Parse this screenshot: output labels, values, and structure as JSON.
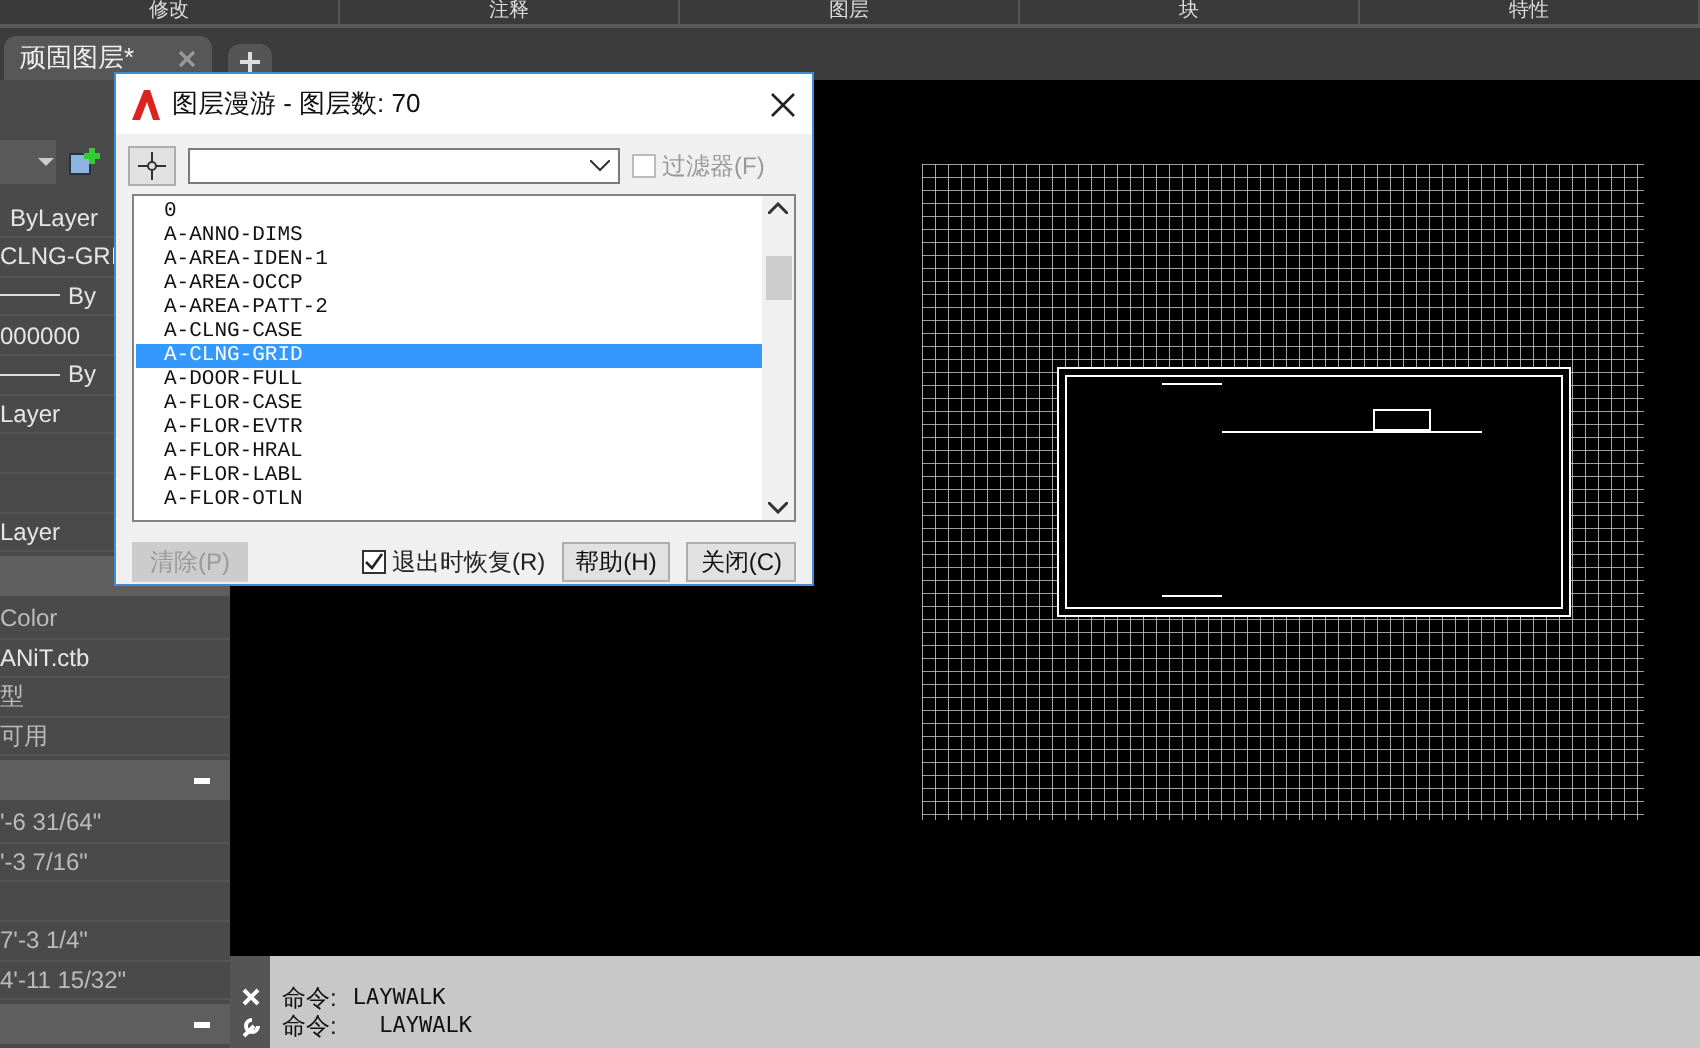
{
  "ribbon_panels": [
    {
      "label": "修改"
    },
    {
      "label": "注释"
    },
    {
      "label": "图层"
    },
    {
      "label": "块"
    },
    {
      "label": "特性"
    }
  ],
  "document_tabs": [
    {
      "label": "顽固图层*",
      "selected": true
    }
  ],
  "properties_palette": {
    "rows": [
      {
        "kind": "dropdown"
      },
      {
        "kind": "text",
        "text": "ByLayer",
        "indent": true
      },
      {
        "kind": "text",
        "text": "CLNG-GRI"
      },
      {
        "kind": "line",
        "text": "By"
      },
      {
        "kind": "text",
        "text": "000000"
      },
      {
        "kind": "line",
        "text": "By"
      },
      {
        "kind": "text",
        "text": "Layer"
      },
      {
        "kind": "blank"
      },
      {
        "kind": "blank"
      },
      {
        "kind": "text",
        "text": "Layer"
      },
      {
        "kind": "header"
      },
      {
        "kind": "text",
        "text": "Color",
        "dim": true
      },
      {
        "kind": "text",
        "text": "ANiT.ctb"
      },
      {
        "kind": "text",
        "text": "型",
        "dim": true
      },
      {
        "kind": "text",
        "text": "可用",
        "dim": true
      },
      {
        "kind": "header"
      },
      {
        "kind": "text",
        "text": "'-6 31/64\"",
        "dim": true
      },
      {
        "kind": "text",
        "text": "'-3 7/16\"",
        "dim": true
      },
      {
        "kind": "blank"
      },
      {
        "kind": "text",
        "text": "7'-3 1/4\"",
        "dim": true
      },
      {
        "kind": "text",
        "text": "4'-11 15/32\"",
        "dim": true
      },
      {
        "kind": "header"
      }
    ]
  },
  "layer_walk_dialog": {
    "title": "图层漫游 - 图层数: 70",
    "filter_checkbox": {
      "label": "过滤器(F)",
      "checked": false,
      "disabled": true
    },
    "layers": [
      {
        "name": "0",
        "selected": false
      },
      {
        "name": "A-ANNO-DIMS",
        "selected": false
      },
      {
        "name": "A-AREA-IDEN-1",
        "selected": false
      },
      {
        "name": "A-AREA-OCCP",
        "selected": false
      },
      {
        "name": "A-AREA-PATT-2",
        "selected": false
      },
      {
        "name": "A-CLNG-CASE",
        "selected": false
      },
      {
        "name": "A-CLNG-GRID",
        "selected": true
      },
      {
        "name": "A-DOOR-FULL",
        "selected": false
      },
      {
        "name": "A-FLOR-CASE",
        "selected": false
      },
      {
        "name": "A-FLOR-EVTR",
        "selected": false
      },
      {
        "name": "A-FLOR-HRAL",
        "selected": false
      },
      {
        "name": "A-FLOR-LABL",
        "selected": false
      },
      {
        "name": "A-FLOR-OTLN",
        "selected": false
      }
    ],
    "purge_button": {
      "label": "清除(P)",
      "disabled": true
    },
    "restore_checkbox": {
      "label": "退出时恢复(R)",
      "checked": true
    },
    "buttons": [
      {
        "label": "帮助(H)"
      },
      {
        "label": "关闭(C)"
      }
    ]
  },
  "command_line": {
    "lines": [
      {
        "prompt": "命令:",
        "command": "LAYWALK"
      },
      {
        "prompt": "命令:",
        "command": "  LAYWALK"
      }
    ]
  }
}
